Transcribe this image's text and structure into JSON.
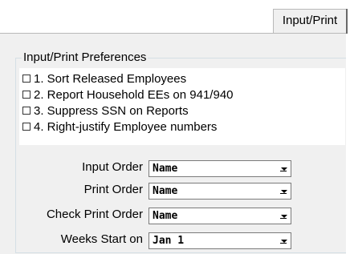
{
  "tabs": [
    {
      "label": "Input/Print",
      "active": true
    }
  ],
  "preferences": {
    "title": "Input/Print Preferences",
    "items": [
      {
        "label": "1. Sort Released Employees",
        "checked": false
      },
      {
        "label": "2. Report Household EEs on 941/940",
        "checked": false
      },
      {
        "label": "3. Suppress SSN on Reports",
        "checked": false
      },
      {
        "label": "4. Right-justify Employee numbers",
        "checked": false
      }
    ]
  },
  "fields": [
    {
      "label": "Input Order",
      "value": "Name"
    },
    {
      "label": "Print Order",
      "value": "Name"
    },
    {
      "label": "Check Print Order",
      "value": "Name"
    },
    {
      "label": "Weeks Start on",
      "value": "Jan 1"
    }
  ],
  "colors": {
    "panel_bg": "#f0f0f0",
    "list_bg": "#ffffff",
    "group_border": "#d5dfe5"
  }
}
